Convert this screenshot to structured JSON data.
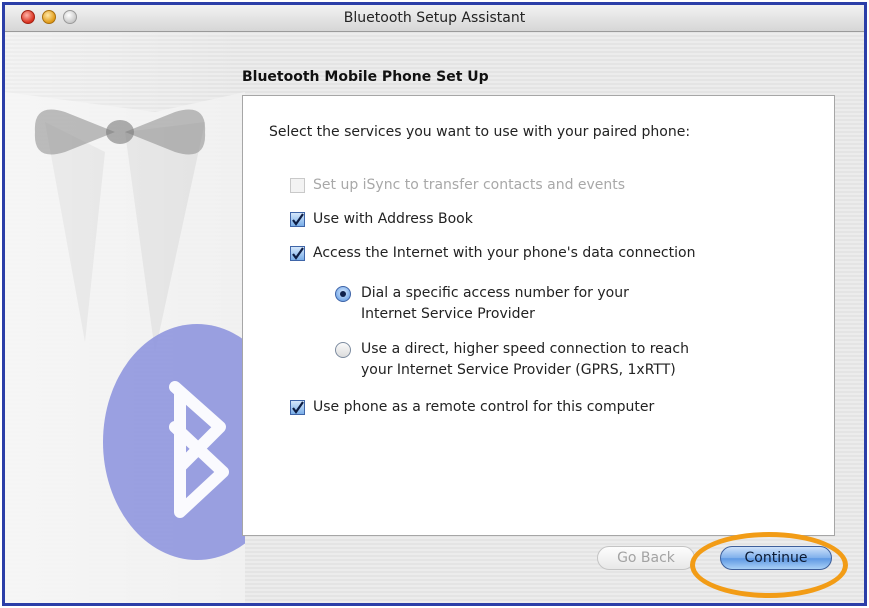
{
  "window": {
    "title": "Bluetooth Setup Assistant",
    "controls": [
      "close-button",
      "minimize-button",
      "zoom-button"
    ]
  },
  "page": {
    "heading": "Bluetooth Mobile Phone Set Up",
    "prompt": "Select the services you want to use with your paired phone:"
  },
  "options": [
    {
      "label": "Set up iSync to transfer contacts and events",
      "checked": false,
      "enabled": false
    },
    {
      "label": "Use with Address Book",
      "checked": true,
      "enabled": true
    },
    {
      "label": "Access the Internet with your phone's data connection",
      "checked": true,
      "enabled": true
    },
    {
      "label": "Use phone as a remote control for this computer",
      "checked": true,
      "enabled": true
    }
  ],
  "radios": [
    {
      "line1": "Dial a specific access number for your",
      "line2": "Internet Service Provider",
      "selected": true
    },
    {
      "line1": "Use a direct, higher speed connection to reach",
      "line2": "your Internet Service Provider (GPRS, 1xRTT)",
      "selected": false
    }
  ],
  "buttons": {
    "back": "Go Back",
    "continue": "Continue"
  },
  "colors": {
    "highlight": "#f29c16",
    "frame": "#2b3ea8",
    "accent": "#5d97e3"
  }
}
